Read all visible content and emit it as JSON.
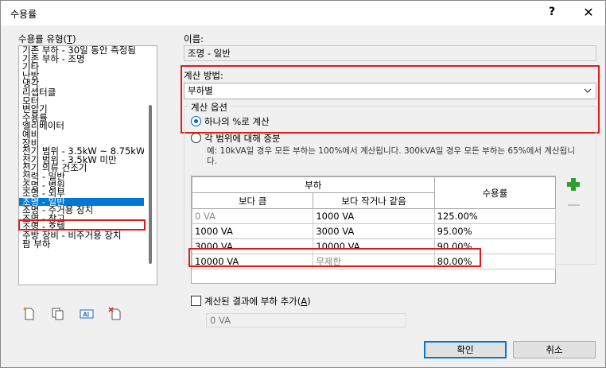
{
  "window": {
    "title": "수용률",
    "help": "?",
    "close": "✕"
  },
  "left": {
    "label_prefix": "수용률 유형(",
    "label_key": "T",
    "label_suffix": ")",
    "items": [
      "기존 부하 - 30일 동안 측정됨",
      "기존 부하 - 조명",
      "기타",
      "난방",
      "냉각",
      "리셉터클",
      "모터",
      "변압기",
      "수용률",
      "엘리베이터",
      "예비",
      "장비",
      "전기 범위 - 3.5kW ~ 8.75kW",
      "전기 범위 - 3.5kW 미만",
      "전기 의류 건조기",
      "전력 - 일반",
      "조명 - 병원",
      "조명 - 외부",
      "조명 - 일반",
      "조명 - 주거용 장치",
      "조명 - 창고",
      "조명 - 호텔",
      "주방 장비 - 비주거용 장치",
      "팜 부하"
    ],
    "selected_index": 18
  },
  "right": {
    "name_label": "이름:",
    "name_value": "조명 - 일반",
    "calc_label": "계산 방법:",
    "calc_value": "부하별",
    "options_legend": "계산 옵션",
    "radio1_label": "하나의 %로 계산",
    "radio2_label": "각 범위에 대해 증분",
    "description": "예: 10kVA일 경우 모든 부하는 100%에서 계산됩니다. 300kVA일 경우 모든 부하는 65%에서 계산됩니다."
  },
  "table": {
    "group_header": "부하",
    "col_greater": "보다 큼",
    "col_less": "보다 작거나 같음",
    "col_factor": "수용률",
    "rows": [
      {
        "greater": "0 VA",
        "less": "1000 VA",
        "factor": "125.00%"
      },
      {
        "greater": "1000 VA",
        "less": "3000 VA",
        "factor": "95.00%"
      },
      {
        "greater": "3000 VA",
        "less": "10000 VA",
        "factor": "90.00%"
      },
      {
        "greater": "10000 VA",
        "less": "무제한",
        "factor": "80.00%"
      }
    ]
  },
  "bottom": {
    "checkbox_label_prefix": "계산된 결과에 부하 추가(",
    "checkbox_key": "A",
    "checkbox_label_suffix": ")",
    "sum_value": "0 VA",
    "ok_label": "확인",
    "cancel_label": "취소"
  },
  "colors": {
    "accent": "#0078d7",
    "highlight": "#e01a1a",
    "add": "#2e9e2e"
  }
}
